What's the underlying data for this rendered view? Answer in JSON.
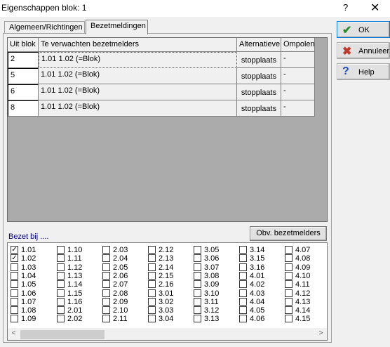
{
  "window": {
    "title": "Eigenschappen blok: 1",
    "help_glyph": "?",
    "close_glyph": "✕"
  },
  "tabs": [
    {
      "label": "Algemeen/Richtingen"
    },
    {
      "label": "Bezetmeldingen"
    }
  ],
  "grid": {
    "headers": [
      "Uit blok",
      "Te verwachten bezetmelders",
      "Alternatieve",
      "Ompolen"
    ],
    "rows": [
      {
        "uit_blok": "2",
        "bezetmelders": "1.01  1.02 (=Blok)",
        "alternatieve": "stopplaats",
        "ompolen": "-"
      },
      {
        "uit_blok": "5",
        "bezetmelders": "1.01  1.02 (=Blok)",
        "alternatieve": "stopplaats",
        "ompolen": "-"
      },
      {
        "uit_blok": "6",
        "bezetmelders": "1.01  1.02 (=Blok)",
        "alternatieve": "stopplaats",
        "ompolen": "-"
      },
      {
        "uit_blok": "8",
        "bezetmelders": "1.01  1.02 (=Blok)",
        "alternatieve": "stopplaats",
        "ompolen": "-"
      }
    ]
  },
  "bezet": {
    "label": "Bezet bij ....",
    "button_label": "Obv. bezetmelders",
    "columns": [
      [
        {
          "label": "1.01",
          "checked": true
        },
        {
          "label": "1.02",
          "checked": true
        },
        {
          "label": "1.03",
          "checked": false
        },
        {
          "label": "1.04",
          "checked": false
        },
        {
          "label": "1.05",
          "checked": false
        },
        {
          "label": "1.06",
          "checked": false
        },
        {
          "label": "1.07",
          "checked": false
        },
        {
          "label": "1.08",
          "checked": false
        },
        {
          "label": "1.09",
          "checked": false
        }
      ],
      [
        {
          "label": "1.10",
          "checked": false
        },
        {
          "label": "1.11",
          "checked": false
        },
        {
          "label": "1.12",
          "checked": false
        },
        {
          "label": "1.13",
          "checked": false
        },
        {
          "label": "1.14",
          "checked": false
        },
        {
          "label": "1.15",
          "checked": false
        },
        {
          "label": "1.16",
          "checked": false
        },
        {
          "label": "2.01",
          "checked": false
        },
        {
          "label": "2.02",
          "checked": false
        }
      ],
      [
        {
          "label": "2.03",
          "checked": false
        },
        {
          "label": "2.04",
          "checked": false
        },
        {
          "label": "2.05",
          "checked": false
        },
        {
          "label": "2.06",
          "checked": false
        },
        {
          "label": "2.07",
          "checked": false
        },
        {
          "label": "2.08",
          "checked": false
        },
        {
          "label": "2.09",
          "checked": false
        },
        {
          "label": "2.10",
          "checked": false
        },
        {
          "label": "2.11",
          "checked": false
        }
      ],
      [
        {
          "label": "2.12",
          "checked": false
        },
        {
          "label": "2.13",
          "checked": false
        },
        {
          "label": "2.14",
          "checked": false
        },
        {
          "label": "2.15",
          "checked": false
        },
        {
          "label": "2.16",
          "checked": false
        },
        {
          "label": "3.01",
          "checked": false
        },
        {
          "label": "3.02",
          "checked": false
        },
        {
          "label": "3.03",
          "checked": false
        },
        {
          "label": "3.04",
          "checked": false
        }
      ],
      [
        {
          "label": "3.05",
          "checked": false
        },
        {
          "label": "3.06",
          "checked": false
        },
        {
          "label": "3.07",
          "checked": false
        },
        {
          "label": "3.08",
          "checked": false
        },
        {
          "label": "3.09",
          "checked": false
        },
        {
          "label": "3.10",
          "checked": false
        },
        {
          "label": "3.11",
          "checked": false
        },
        {
          "label": "3.12",
          "checked": false
        },
        {
          "label": "3.13",
          "checked": false
        }
      ],
      [
        {
          "label": "3.14",
          "checked": false
        },
        {
          "label": "3.15",
          "checked": false
        },
        {
          "label": "3.16",
          "checked": false
        },
        {
          "label": "4.01",
          "checked": false
        },
        {
          "label": "4.02",
          "checked": false
        },
        {
          "label": "4.03",
          "checked": false
        },
        {
          "label": "4.04",
          "checked": false
        },
        {
          "label": "4.05",
          "checked": false
        },
        {
          "label": "4.06",
          "checked": false
        }
      ],
      [
        {
          "label": "4.07",
          "checked": false
        },
        {
          "label": "4.08",
          "checked": false
        },
        {
          "label": "4.09",
          "checked": false
        },
        {
          "label": "4.10",
          "checked": false
        },
        {
          "label": "4.11",
          "checked": false
        },
        {
          "label": "4.12",
          "checked": false
        },
        {
          "label": "4.13",
          "checked": false
        },
        {
          "label": "4.14",
          "checked": false
        },
        {
          "label": "4.15",
          "checked": false
        }
      ]
    ]
  },
  "buttons": {
    "ok": {
      "label": "OK",
      "icon": "checkmark-icon",
      "color": "#2e8b2e"
    },
    "cancel": {
      "label": "Annuleer",
      "icon": "x-icon",
      "color": "#c0392b"
    },
    "help": {
      "label": "Help",
      "icon": "question-icon",
      "color": "#1f4fbf"
    }
  },
  "scroll_glyphs": {
    "left": "<",
    "right": ">"
  }
}
